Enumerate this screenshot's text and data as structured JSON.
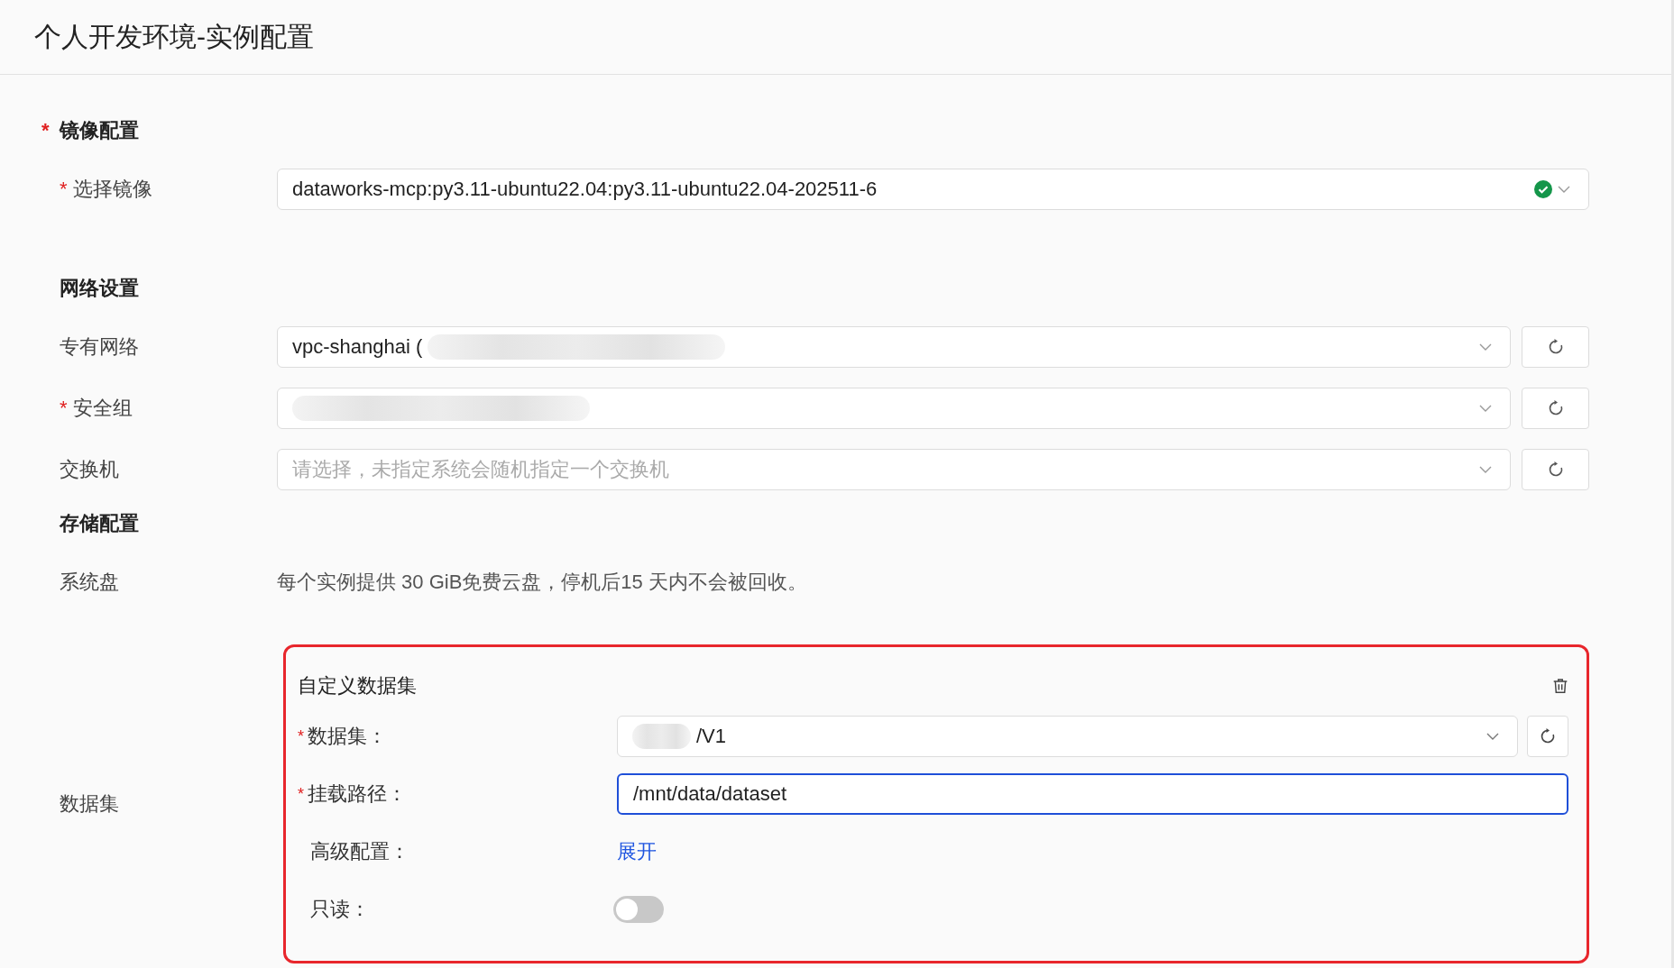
{
  "page_title": "个人开发环境-实例配置",
  "rows": [
    {
      "kind": "heading",
      "label": "镜像配置",
      "required": "*"
    },
    {
      "kind": "select",
      "label": "选择镜像",
      "required": "*",
      "value": "dataworks-mcp:py3.11-ubuntu22.04:py3.11-ubuntu22.04-202511-6",
      "verified": true
    },
    {
      "kind": "heading",
      "label": "网络设置"
    },
    {
      "kind": "select",
      "label": "专有网络",
      "value": "vpc-shanghai (",
      "refresh": true,
      "redacted": true
    },
    {
      "kind": "select",
      "label": "安全组",
      "required": "*",
      "refresh": true,
      "redacted": true
    },
    {
      "kind": "select",
      "label": "交换机",
      "placeholder": "请选择，未指定系统会随机指定一个交换机",
      "refresh": true
    },
    {
      "kind": "heading",
      "label": "存储配置"
    },
    {
      "kind": "text",
      "label": "系统盘",
      "text": "每个实例提供 30 GiB免费云盘，停机后15 天内不会被回收。"
    },
    {
      "kind": "dataset",
      "label": "数据集",
      "card": {
        "title": "自定义数据集",
        "highlighted": true,
        "fields": [
          {
            "kind": "select",
            "label": "数据集：",
            "required": "*",
            "value": "/V1",
            "redacted": true
          },
          {
            "kind": "input",
            "label": "挂载路径：",
            "required": "*",
            "value": "/mnt/data/dataset",
            "focused": true
          },
          {
            "kind": "link",
            "label": "高级配置：",
            "link": "展开"
          },
          {
            "kind": "toggle",
            "label": "只读：",
            "on": false
          }
        ]
      }
    }
  ]
}
